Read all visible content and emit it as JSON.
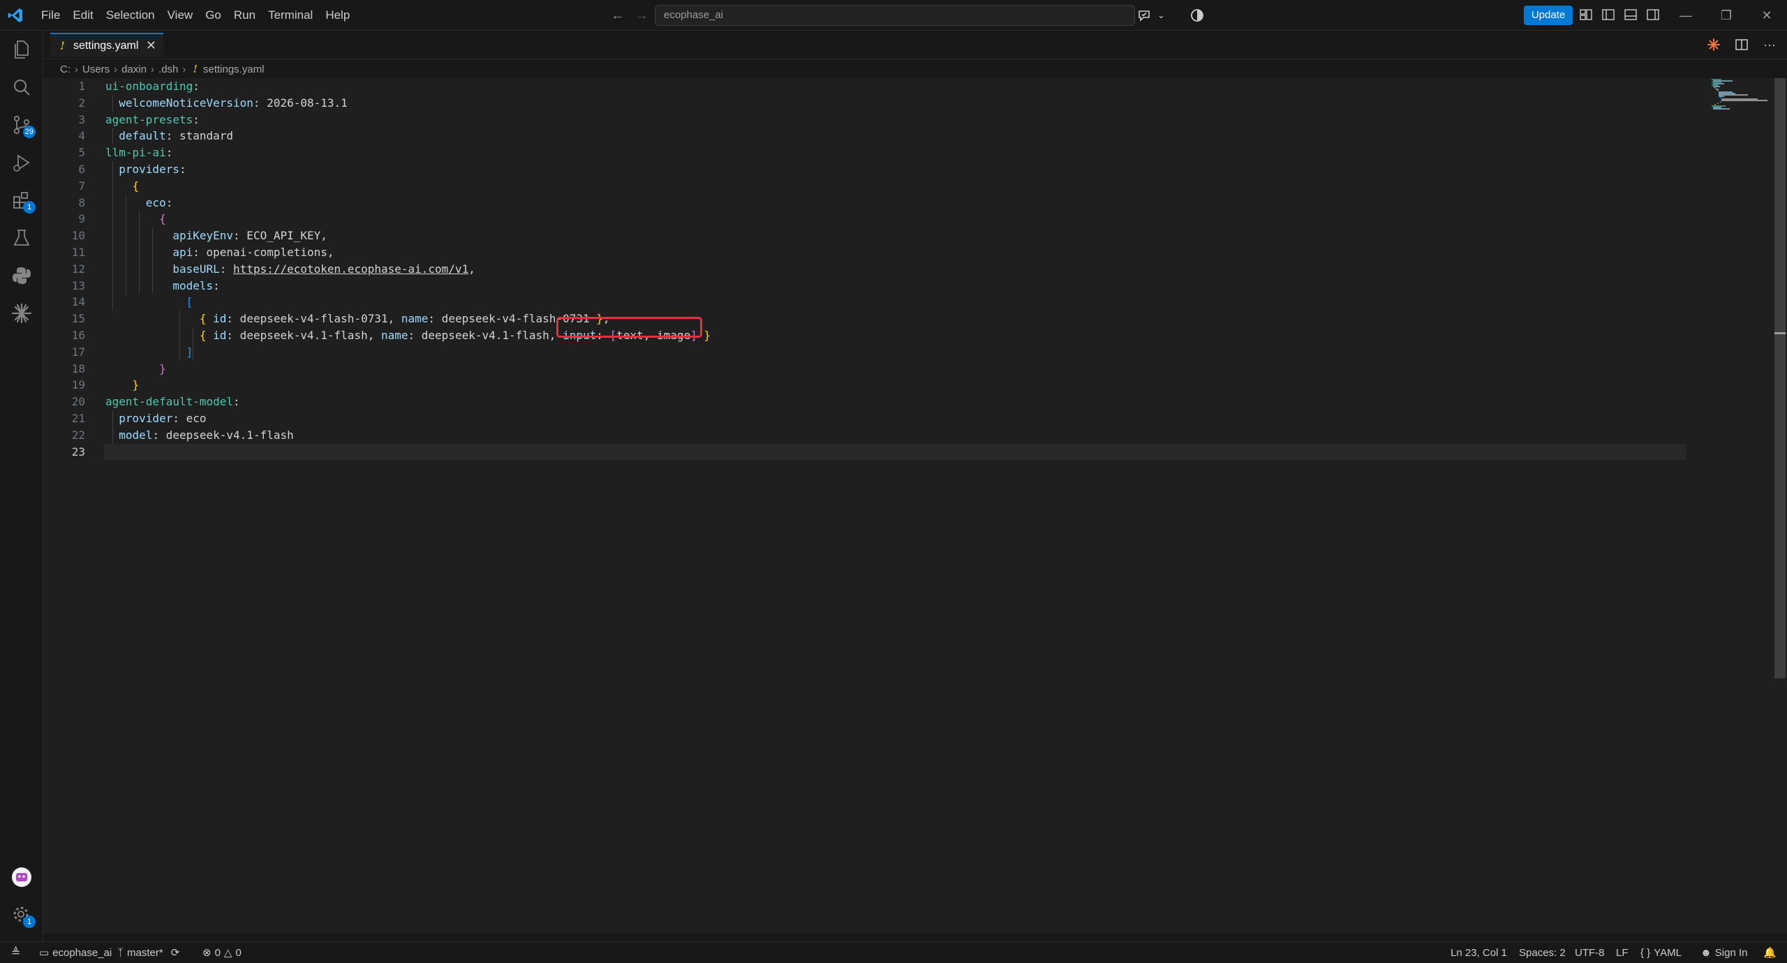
{
  "menubar": {
    "items": [
      "File",
      "Edit",
      "Selection",
      "View",
      "Go",
      "Run",
      "Terminal",
      "Help"
    ]
  },
  "command_center": {
    "text": "ecophase_ai"
  },
  "titlebar": {
    "update_label": "Update"
  },
  "activitybar": {
    "source_control_badge": "29",
    "extensions_badge": "1",
    "settings_badge": "1"
  },
  "tab": {
    "label": "settings.yaml",
    "warn_glyph": "!"
  },
  "breadcrumb": {
    "items": [
      "C:",
      "Users",
      "daxin",
      ".dsh",
      "settings.yaml"
    ],
    "warn_glyph": "!"
  },
  "editor": {
    "language": "yaml",
    "lines": [
      "ui-onboarding:",
      "  welcomeNoticeVersion: 2026-08-13.1",
      "agent-presets:",
      "  default: standard",
      "llm-pi-ai:",
      "  providers:",
      "    {",
      "      eco:",
      "        {",
      "          apiKeyEnv: ECO_API_KEY,",
      "          api: openai-completions,",
      "          baseURL: https://ecotoken.ecophase-ai.com/v1,",
      "          models:",
      "            [",
      "              { id: deepseek-v4-flash-0731, name: deepseek-v4-flash-0731 },",
      "              { id: deepseek-v4.1-flash, name: deepseek-v4.1-flash, input: [text, image] }",
      "            ]",
      "        }",
      "    }",
      "agent-default-model:",
      "  provider: eco",
      "  model: deepseek-v4.1-flash",
      ""
    ],
    "highlighted_text": "input: [text, image]",
    "current_line": 23
  },
  "statusbar": {
    "remote": "ecophase_ai",
    "branch": "master*",
    "errors": "0",
    "warnings": "0",
    "cursor": "Ln 23, Col 1",
    "spaces": "Spaces: 2",
    "encoding": "UTF-8",
    "eol": "LF",
    "language": "YAML",
    "language_prefix": "{ }",
    "sign_in": "Sign In"
  },
  "colors": {
    "accent": "#0078d4",
    "highlight_box": "#e5303f",
    "warning": "#cca700"
  }
}
